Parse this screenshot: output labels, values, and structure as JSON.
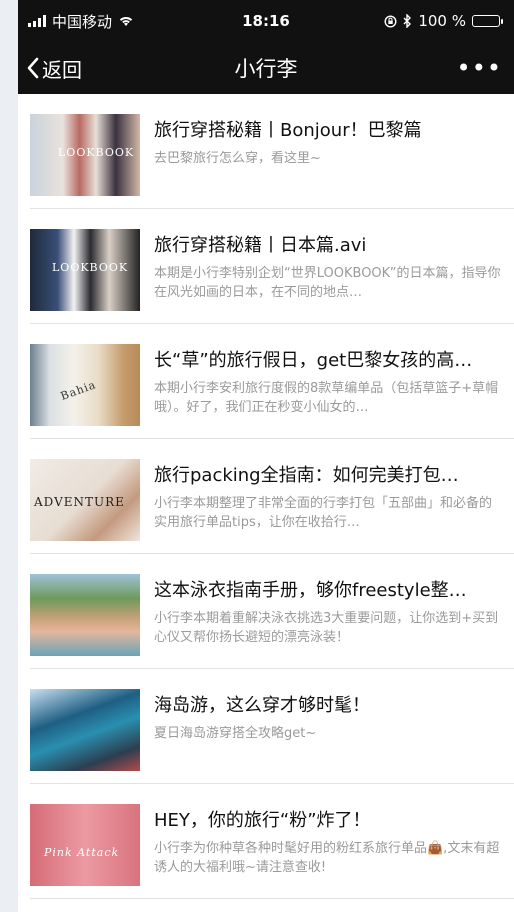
{
  "status_bar": {
    "carrier": "中国移动",
    "time": "18:16",
    "battery": "100 %",
    "battery_level": 1.0
  },
  "nav": {
    "back_label": "返回",
    "title": "小行李",
    "more_label": "•••"
  },
  "articles": [
    {
      "title": "旅行穿搭秘籍丨Bonjour！巴黎篇",
      "desc": "去巴黎旅行怎么穿，看这里~",
      "thumb_label": "LOOKBOOK"
    },
    {
      "title": "旅行穿搭秘籍丨日本篇.avi",
      "desc": "本期是小行李特别企划“世界LOOKBOOK”的日本篇，指导你在风光如画的日本，在不同的地点…",
      "thumb_label": "LOOKBOOK"
    },
    {
      "title": "长“草”的旅行假日，get巴黎女孩的高…",
      "desc": "本期小行李安利旅行度假的8款草编单品（包括草篮子+草帽哦）。好了，我们正在秒变小仙女的…",
      "thumb_label": "Bahia"
    },
    {
      "title": "旅行packing全指南：如何完美打包…",
      "desc": "小行李本期整理了非常全面的行李打包「五部曲」和必备的实用旅行单品tips，让你在收拾行…",
      "thumb_label": "ADVENTURE"
    },
    {
      "title": "这本泳衣指南手册，够你freestyle整…",
      "desc": "小行李本期着重解决泳衣挑选3大重要问题，让你选到+买到心仪又帮你扬长避短的漂亮泳装！",
      "thumb_label": ""
    },
    {
      "title": "海岛游，这么穿才够时髦！",
      "desc": "夏日海岛游穿搭全攻略get~",
      "thumb_label": ""
    },
    {
      "title": "HEY，你的旅行“粉”炸了！",
      "desc": "小行李为你种草各种时髦好用的粉红系旅行单品👜,文末有超诱人的大福利哦~请注意查收!",
      "thumb_label": "Pink Attack"
    }
  ],
  "colors": {
    "bar_bg": "#111111",
    "battery_green": "#4cd964"
  }
}
